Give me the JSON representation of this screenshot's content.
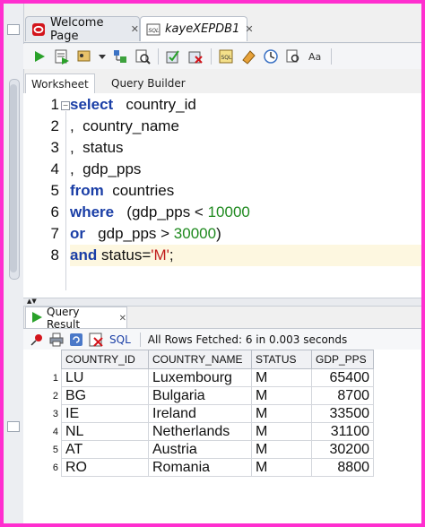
{
  "tabs": [
    {
      "label": "Welcome Page",
      "icon": "oracle-icon"
    },
    {
      "label": "kayeXEPDB1",
      "icon": "sql-worksheet-icon"
    }
  ],
  "subtabs": [
    "Worksheet",
    "Query Builder"
  ],
  "editor": {
    "line_numbers": [
      "1",
      "2",
      "3",
      "4",
      "5",
      "6",
      "7",
      "8"
    ],
    "lines": [
      {
        "kw": "select",
        "rest": "   country_id"
      },
      {
        "kw": "",
        "rest": ",  country_name"
      },
      {
        "kw": "",
        "rest": ",  status"
      },
      {
        "kw": "",
        "rest": ",  gdp_pps"
      },
      {
        "kw": "from",
        "rest": "  countries"
      },
      {
        "kw": "where",
        "rest": "   (gdp_pps < ",
        "num": "10000"
      },
      {
        "kw": "or",
        "rest": "   gdp_pps > ",
        "num": "30000",
        "tail": ")"
      },
      {
        "kw": "and",
        "rest": " status=",
        "str": "'M'",
        "tail": ";"
      }
    ]
  },
  "results": {
    "tab_label": "Query Result",
    "sql_label": "SQL",
    "status": "All Rows Fetched: 6 in 0.003 seconds",
    "columns": [
      "COUNTRY_ID",
      "COUNTRY_NAME",
      "STATUS",
      "GDP_PPS"
    ],
    "rows": [
      {
        "n": "1",
        "id": "LU",
        "name": "Luxembourg",
        "status": "M",
        "gdp": "65400"
      },
      {
        "n": "2",
        "id": "BG",
        "name": "Bulgaria",
        "status": "M",
        "gdp": "8700"
      },
      {
        "n": "3",
        "id": "IE",
        "name": "Ireland",
        "status": "M",
        "gdp": "33500"
      },
      {
        "n": "4",
        "id": "NL",
        "name": "Netherlands",
        "status": "M",
        "gdp": "31100"
      },
      {
        "n": "5",
        "id": "AT",
        "name": "Austria",
        "status": "M",
        "gdp": "30200"
      },
      {
        "n": "6",
        "id": "RO",
        "name": "Romania",
        "status": "M",
        "gdp": "8800"
      }
    ]
  },
  "colors": {
    "border": "#ff2ecf",
    "keyword": "#1a3ea6",
    "number": "#1f8a1f",
    "string": "#c01c1c"
  }
}
